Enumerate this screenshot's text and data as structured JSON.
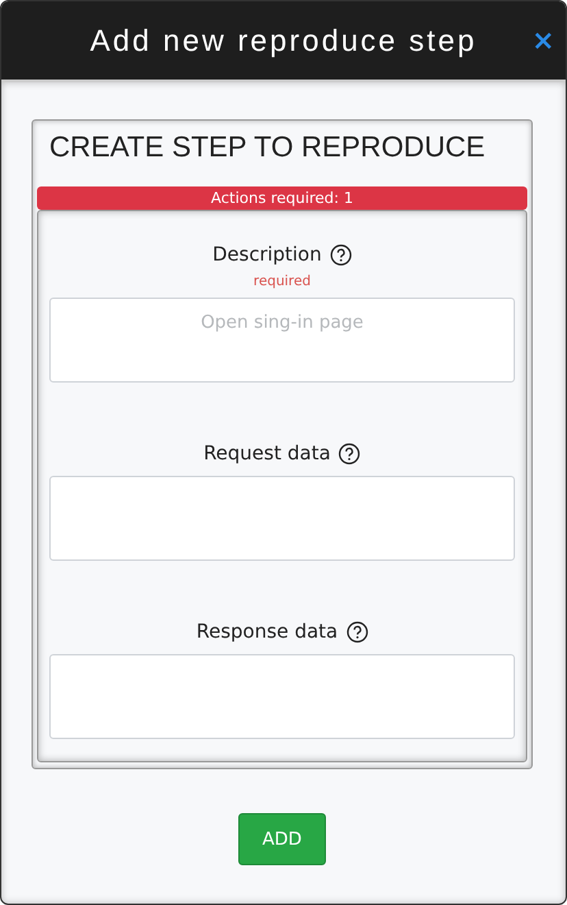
{
  "window": {
    "title": "Add new reproduce step",
    "close": "×"
  },
  "card": {
    "title": "CREATE STEP TO REPRODUCE",
    "alert": "Actions required: 1"
  },
  "fields": [
    {
      "label": "Description",
      "note": "required",
      "placeholder": "Open sing-in page"
    },
    {
      "label": "Request data"
    },
    {
      "label": "Response data"
    }
  ],
  "buttons": [
    "ADD"
  ]
}
